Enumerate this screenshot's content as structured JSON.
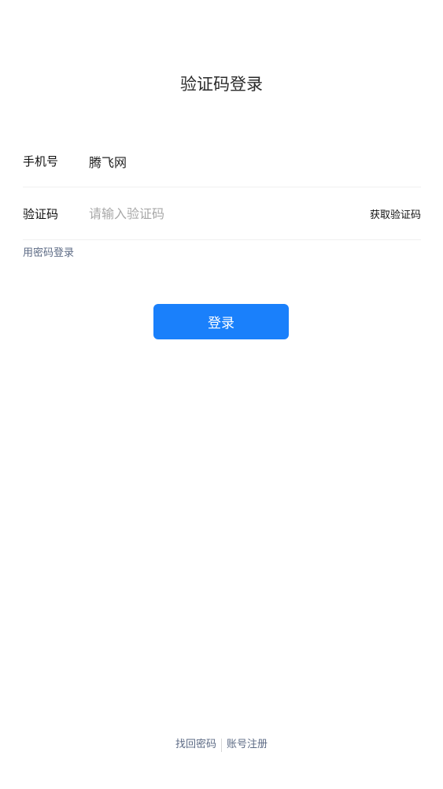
{
  "page": {
    "title": "验证码登录"
  },
  "form": {
    "phone": {
      "label": "手机号",
      "value": "腾飞网"
    },
    "code": {
      "label": "验证码",
      "value": "",
      "placeholder": "请输入验证码",
      "get_code_label": "获取验证码"
    },
    "password_login_label": "用密码登录",
    "submit_label": "登录"
  },
  "footer": {
    "recover_password_label": "找回密码",
    "register_label": "账号注册"
  },
  "colors": {
    "primary": "#1a80fb",
    "link": "#5d6b85",
    "placeholder": "#a8a8a8",
    "divider": "#f0f0f0"
  }
}
